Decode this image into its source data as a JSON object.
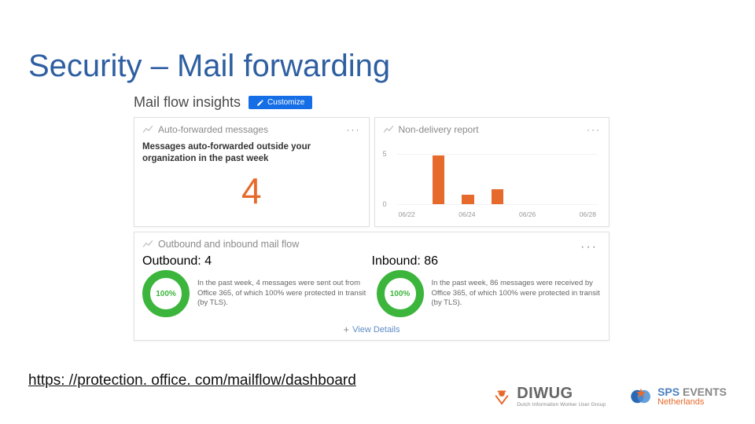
{
  "slide": {
    "title": "Security – Mail forwarding",
    "url": "https: //protection. office. com/mailflow/dashboard"
  },
  "panel": {
    "title": "Mail flow insights",
    "customize": "Customize"
  },
  "cards": {
    "autofwd": {
      "title": "Auto-forwarded messages",
      "more": "···",
      "label": "Messages auto-forwarded outside your organization in the past week",
      "value": "4"
    },
    "ndr": {
      "title": "Non-delivery report",
      "more": "···"
    },
    "mailflow": {
      "title": "Outbound and inbound mail flow",
      "more": "···",
      "outbound_label": "Outbound:",
      "outbound_value": "4",
      "outbound_pct": "100%",
      "outbound_text": "In the past week, 4 messages were sent out from Office 365, of which 100% were protected in transit (by TLS).",
      "inbound_label": "Inbound:",
      "inbound_value": "86",
      "inbound_pct": "100%",
      "inbound_text": "In the past week, 86 messages were received by Office 365, of which 100% were protected in transit (by TLS).",
      "view_details": "View Details"
    }
  },
  "footer": {
    "diwug": {
      "name": "DIWUG",
      "sub": "Dutch Information Worker User Group"
    },
    "sps": {
      "brand": "SPS",
      "suffix": "EVENTS",
      "region": "Netherlands"
    }
  },
  "chart_data": {
    "type": "bar",
    "categories": [
      "06/22",
      "06/24",
      "06/26",
      "06/28"
    ],
    "values": [
      0,
      5,
      1,
      1.5,
      0,
      0,
      0
    ],
    "yticks": [
      "5",
      "0"
    ],
    "ylim": [
      0,
      6
    ],
    "title": "Non-delivery report"
  }
}
